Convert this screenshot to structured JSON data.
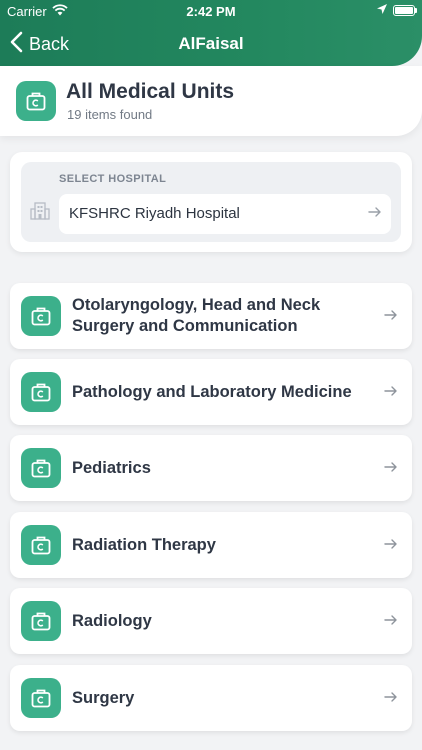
{
  "status_bar": {
    "carrier": "Carrier",
    "time": "2:42 PM"
  },
  "nav": {
    "back_label": "Back",
    "title": "AlFaisal"
  },
  "summary": {
    "title": "All Medical Units",
    "subtitle": "19 items found",
    "icon": "medical-bag-icon"
  },
  "hospital_select": {
    "label": "SELECT HOSPITAL",
    "value": "KFSHRC Riyadh Hospital",
    "icon": "building-icon"
  },
  "units": [
    {
      "label": "Otolaryngology, Head and Neck Surgery and Communication"
    },
    {
      "label": "Pathology and Laboratory Medicine"
    },
    {
      "label": "Pediatrics"
    },
    {
      "label": "Radiation Therapy"
    },
    {
      "label": "Radiology"
    },
    {
      "label": "Surgery"
    }
  ],
  "colors": {
    "header": "#1d7c58",
    "accent": "#3cb08b",
    "background": "#f2f3f5"
  }
}
